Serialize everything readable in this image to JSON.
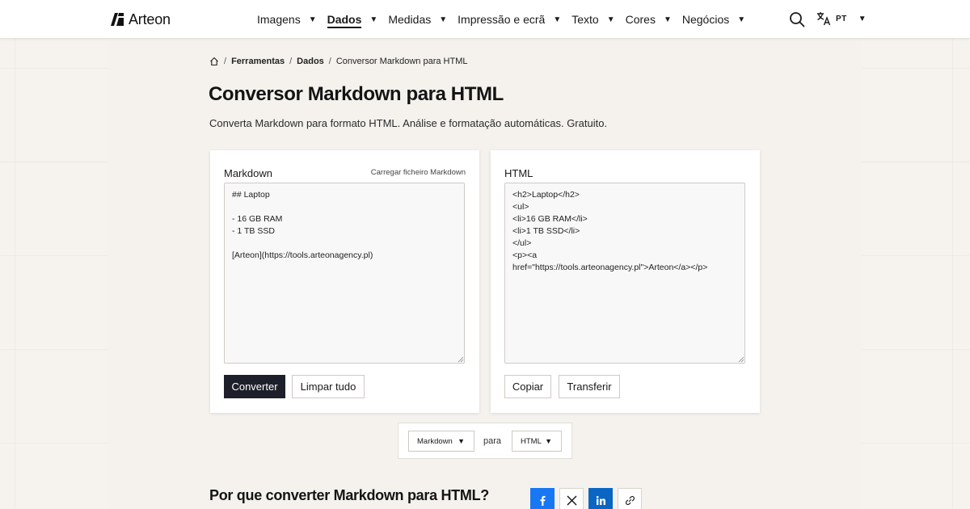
{
  "brand": {
    "name": "Arteon"
  },
  "nav": {
    "items": [
      {
        "label": "Imagens",
        "active": false
      },
      {
        "label": "Dados",
        "active": true
      },
      {
        "label": "Medidas",
        "active": false
      },
      {
        "label": "Impressão e ecrã",
        "active": false
      },
      {
        "label": "Texto",
        "active": false
      },
      {
        "label": "Cores",
        "active": false
      },
      {
        "label": "Negócios",
        "active": false
      }
    ],
    "caret": "▼",
    "language": "PT"
  },
  "breadcrumb": {
    "items": [
      "Ferramentas",
      "Dados",
      "Conversor Markdown para HTML"
    ],
    "separator": "/"
  },
  "page": {
    "title": "Conversor Markdown para HTML",
    "description": "Converta Markdown para formato HTML. Análise e formatação automáticas. Gratuito."
  },
  "input_card": {
    "label": "Markdown",
    "upload_link": "Carregar ficheiro Markdown",
    "content": "## Laptop\n\n- 16 GB RAM\n- 1 TB SSD\n\n[Arteon](https://tools.arteonagency.pl)",
    "convert_button": "Converter",
    "clear_button": "Limpar tudo"
  },
  "output_card": {
    "label": "HTML",
    "content": "<h2>Laptop</h2>\n<ul>\n<li>16 GB RAM</li>\n<li>1 TB SSD</li>\n</ul>\n<p><a\nhref=\"https://tools.arteonagency.pl\">Arteon</a></p>",
    "copy_button": "Copiar",
    "download_button": "Transferir"
  },
  "format_selector": {
    "from": "Markdown",
    "connector": "para",
    "to": "HTML"
  },
  "section": {
    "why_title": "Por que converter Markdown para HTML?"
  },
  "share": {
    "icons": [
      "facebook-icon",
      "x-icon",
      "linkedin-icon",
      "link-icon"
    ]
  },
  "colors": {
    "primary_button": "#1d1f2a",
    "page_background": "#f6f3ef",
    "facebook": "#1877f2",
    "x": "#ffffff",
    "linkedin": "#0a66c2"
  }
}
